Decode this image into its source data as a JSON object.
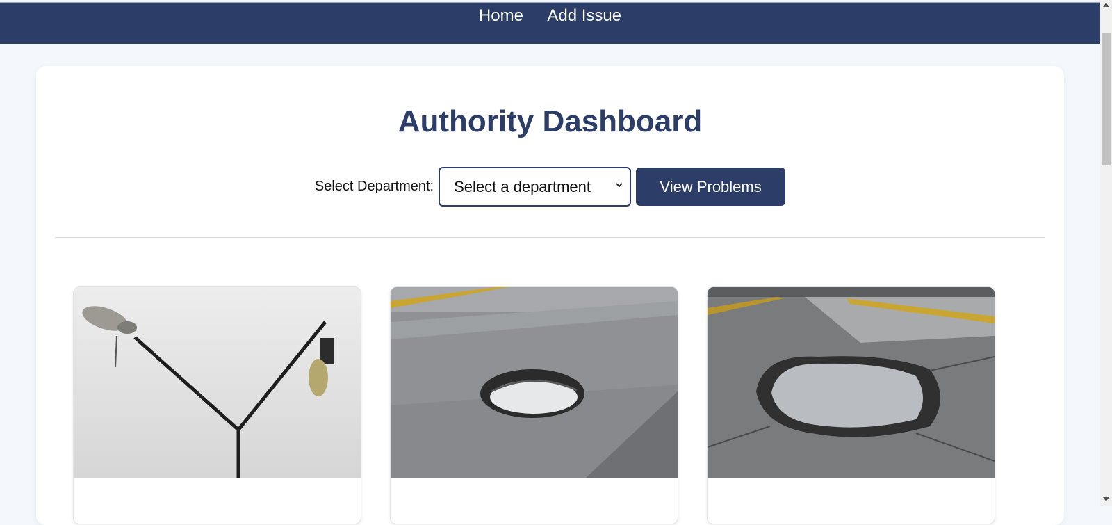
{
  "nav": {
    "home": "Home",
    "add_issue": "Add Issue"
  },
  "dashboard": {
    "title": "Authority Dashboard",
    "department_label": "Select Department:",
    "department_select_value": "Select a department",
    "view_button": "View Problems"
  },
  "problems": [
    {
      "image": "broken-street-light"
    },
    {
      "image": "road-pothole"
    },
    {
      "image": "road-pothole-water"
    }
  ],
  "colors": {
    "primary": "#2c3e68",
    "page_bg": "#f4f7fb"
  }
}
